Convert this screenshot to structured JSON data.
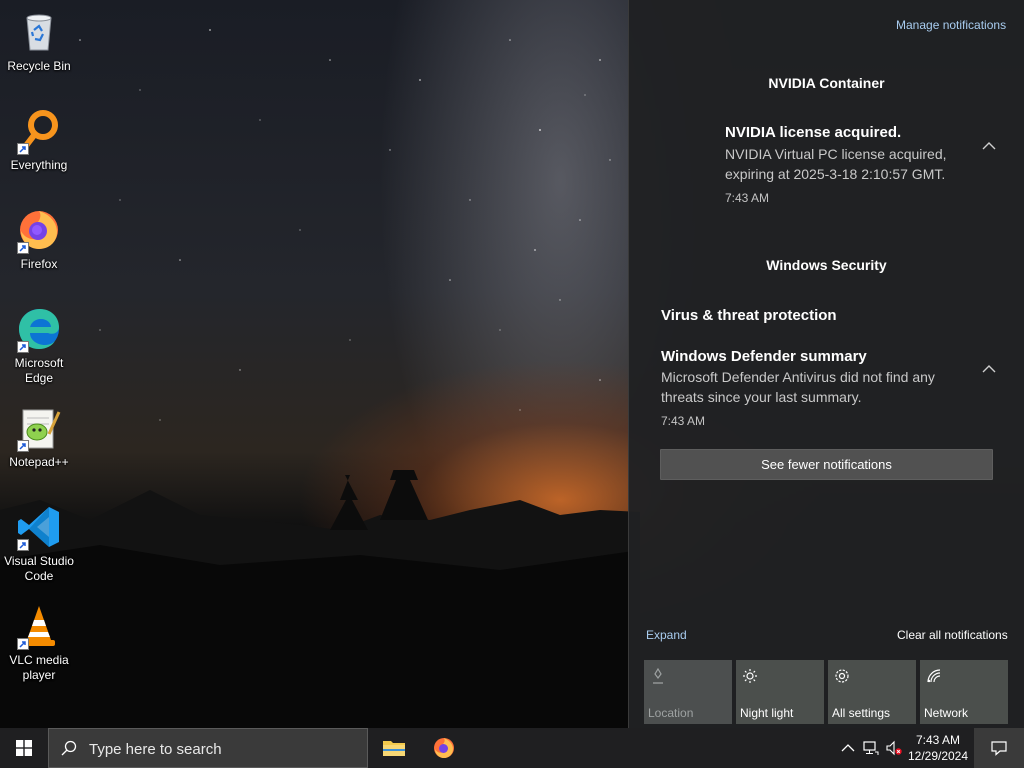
{
  "desktop": {
    "icons": [
      {
        "label": "Recycle Bin",
        "icon": "recycle-bin-icon"
      },
      {
        "label": "Everything",
        "icon": "everything-search-icon"
      },
      {
        "label": "Firefox",
        "icon": "firefox-icon"
      },
      {
        "label": "Microsoft Edge",
        "icon": "edge-icon"
      },
      {
        "label": "Notepad++",
        "icon": "notepadpp-icon"
      },
      {
        "label": "Visual Studio Code",
        "icon": "vscode-icon"
      },
      {
        "label": "VLC media player",
        "icon": "vlc-icon"
      }
    ]
  },
  "action_center": {
    "manage_link": "Manage notifications",
    "groups": [
      {
        "app": "NVIDIA Container",
        "notifications": [
          {
            "title": "NVIDIA license acquired.",
            "body": "NVIDIA Virtual PC license acquired, expiring at 2025-3-18 2:10:57 GMT.",
            "time": "7:43 AM"
          }
        ]
      },
      {
        "app": "Windows Security",
        "notifications": [
          {
            "title": "Virus & threat protection"
          },
          {
            "title": "Windows Defender summary",
            "body": "Microsoft Defender Antivirus did not find any threats since your last summary.",
            "time": "7:43 AM"
          }
        ]
      }
    ],
    "fewer_button": "See fewer notifications",
    "expand_link": "Expand",
    "clear_all_link": "Clear all notifications",
    "quick_actions": [
      {
        "label": "Location",
        "icon": "location-icon",
        "enabled": false
      },
      {
        "label": "Night light",
        "icon": "night-light-icon",
        "enabled": true
      },
      {
        "label": "All settings",
        "icon": "gear-icon",
        "enabled": true
      },
      {
        "label": "Network",
        "icon": "network-icon",
        "enabled": true
      }
    ]
  },
  "taskbar": {
    "search_placeholder": "Type here to search",
    "pinned": [
      {
        "name": "File Explorer",
        "icon": "folder-icon"
      },
      {
        "name": "Firefox",
        "icon": "firefox-icon"
      }
    ],
    "clock": {
      "time": "7:43 AM",
      "date": "12/29/2024"
    }
  },
  "colors": {
    "action_center_bg": "#202123",
    "link_blue": "#a9cdf0",
    "taskbar_bg": "#1f1f21",
    "tile_bg": "#4b4f4c"
  }
}
